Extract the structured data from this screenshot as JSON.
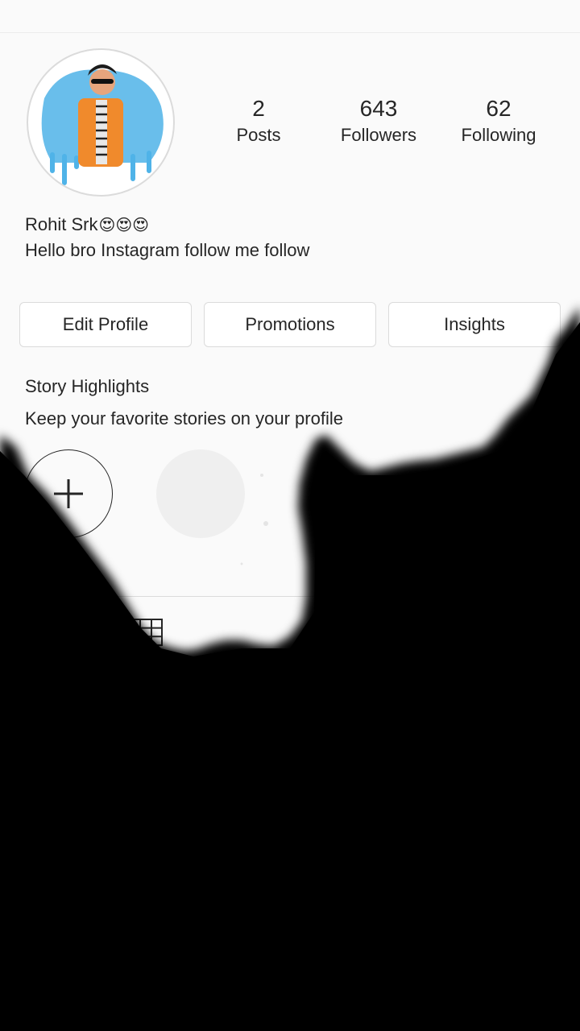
{
  "profile": {
    "name": "Rohit Srk",
    "name_emojis": "😍😍😍",
    "bio": "Hello bro Instagram follow me follow"
  },
  "stats": {
    "posts": {
      "count": "2",
      "label": "Posts"
    },
    "followers": {
      "count": "643",
      "label": "Followers"
    },
    "following": {
      "count": "62",
      "label": "Following"
    }
  },
  "buttons": {
    "edit_profile": "Edit Profile",
    "promotions": "Promotions",
    "insights": "Insights"
  },
  "highlights": {
    "title": "Story Highlights",
    "subtitle": "Keep your favorite stories on your profile"
  },
  "icons": {
    "add_highlight": "plus-icon",
    "grid_tab": "grid-icon"
  },
  "colors": {
    "text": "#262626",
    "border": "#dbdbdb",
    "background": "#fafafa",
    "overlay": "#000000"
  }
}
